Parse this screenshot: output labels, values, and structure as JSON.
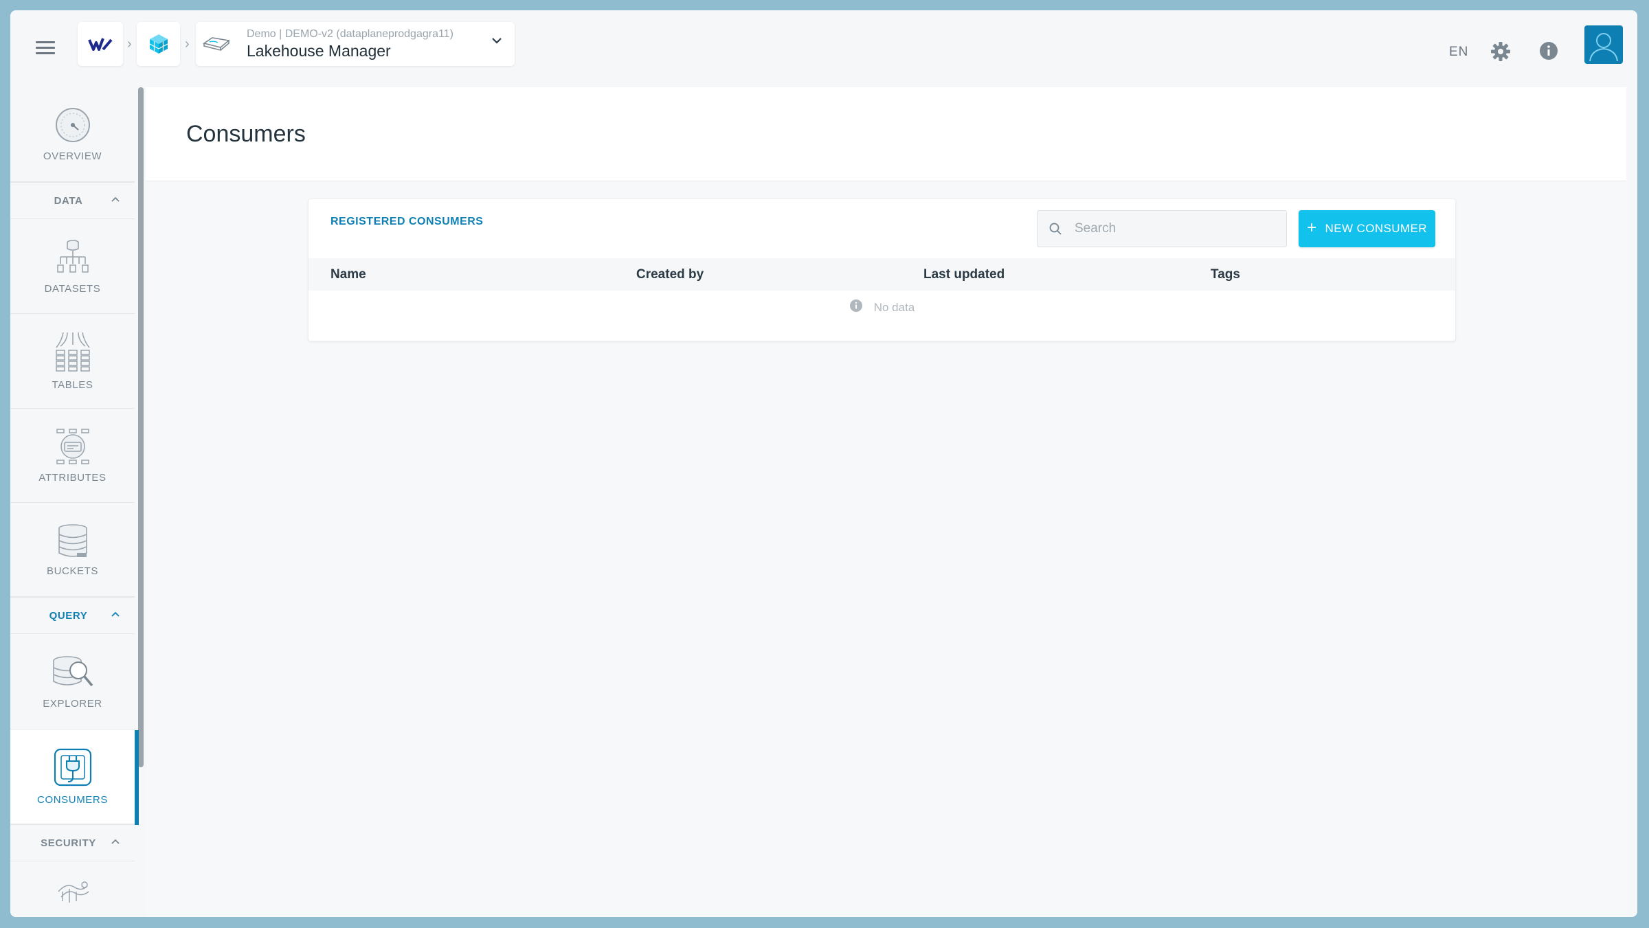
{
  "header": {
    "breadcrumb_sub": "Demo | DEMO-v2 (dataplaneprodgagra11)",
    "app_title": "Lakehouse Manager",
    "language": "EN"
  },
  "sidebar": {
    "overview": "OVERVIEW",
    "sections": {
      "data": "DATA",
      "query": "QUERY",
      "security": "SECURITY"
    },
    "items": {
      "datasets": "DATASETS",
      "tables": "TABLES",
      "attributes": "ATTRIBUTES",
      "buckets": "BUCKETS",
      "explorer": "EXPLORER",
      "consumers": "CONSUMERS"
    }
  },
  "page": {
    "title": "Consumers"
  },
  "card": {
    "title": "REGISTERED CONSUMERS",
    "search_placeholder": "Search",
    "new_button": "NEW CONSUMER",
    "columns": [
      "Name",
      "Created by",
      "Last updated",
      "Tags"
    ],
    "empty_text": "No data"
  },
  "colors": {
    "accent": "#0e7fb3",
    "button": "#12c1ec"
  }
}
